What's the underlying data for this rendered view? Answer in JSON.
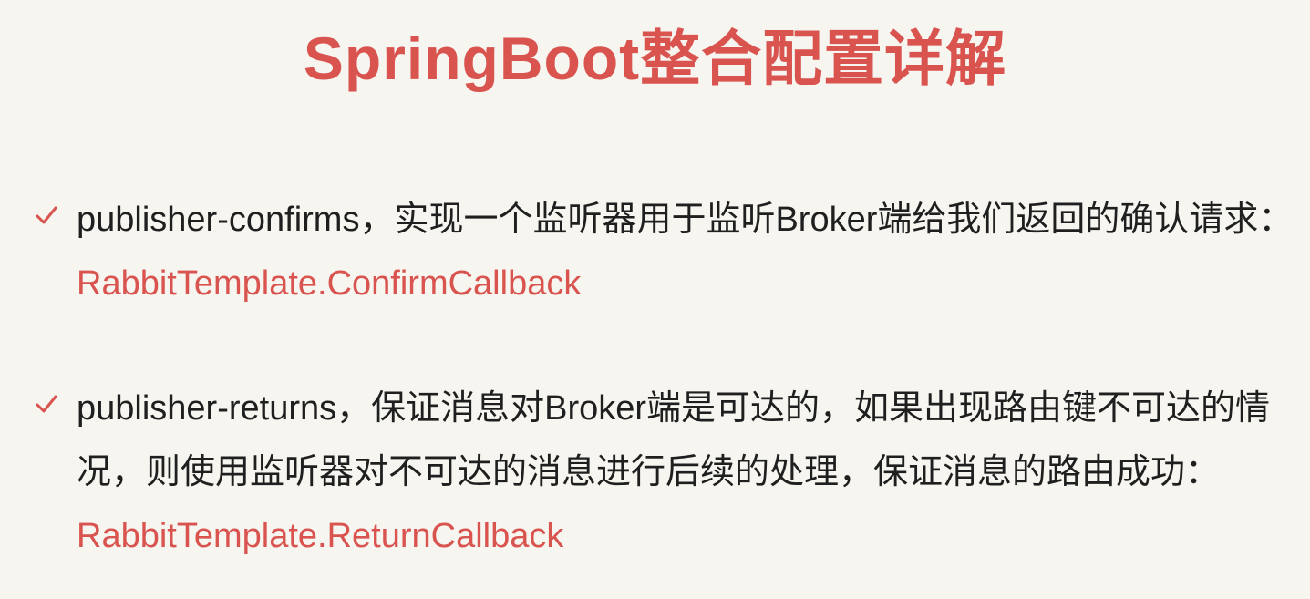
{
  "slide": {
    "title": "SpringBoot整合配置详解",
    "bullets": [
      {
        "line1": "publisher-confirms，实现一个监听器用于监听Broker端给我们返回的确认请求：",
        "line2": "RabbitTemplate.ConfirmCallback"
      },
      {
        "line1": "publisher-returns，保证消息对Broker端是可达的，如果出现路由键不可达的情",
        "line2": "况，则使用监听器对不可达的消息进行后续的处理，保证消息的路由成功：",
        "line3": "RabbitTemplate.ReturnCallback"
      }
    ]
  },
  "colors": {
    "accent": "#d9534f",
    "text": "#1f1f1f",
    "background": "#f6f5f0"
  },
  "icons": {
    "bullet": "check-icon"
  }
}
